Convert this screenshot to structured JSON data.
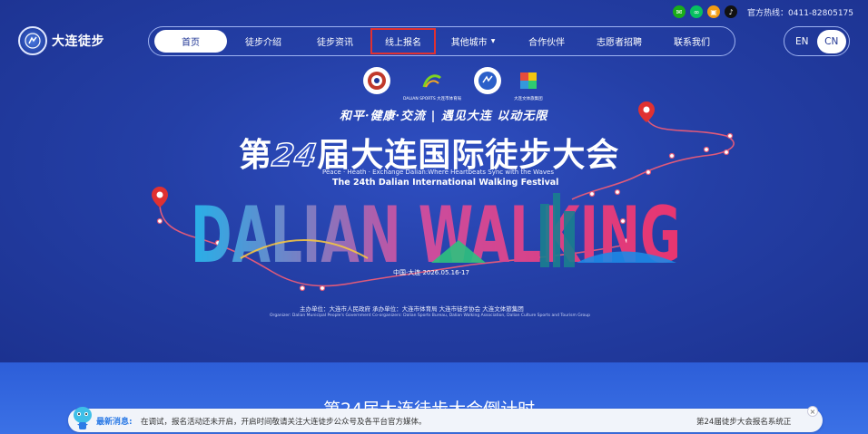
{
  "topbar": {
    "social": [
      {
        "icon": "wechat-icon",
        "color": "#1aad19",
        "glyph": "✉"
      },
      {
        "icon": "miniprogram-icon",
        "color": "#07c160",
        "glyph": "∞"
      },
      {
        "icon": "shop-icon",
        "color": "#f39c12",
        "glyph": "▣"
      },
      {
        "icon": "douyin-icon",
        "color": "#111111",
        "glyph": "♪"
      }
    ],
    "hotline": "官方热线：0411-82805175"
  },
  "logo": {
    "text": "大连徒步"
  },
  "nav": {
    "items": [
      {
        "label": "首页",
        "active": true
      },
      {
        "label": "徒步介绍"
      },
      {
        "label": "徒步资讯"
      },
      {
        "label": "线上报名",
        "highlighted": true
      },
      {
        "label": "其他城市",
        "dropdown": true
      },
      {
        "label": "合作伙伴"
      },
      {
        "label": "志愿者招聘"
      },
      {
        "label": "联系我们"
      }
    ]
  },
  "lang": {
    "en": "EN",
    "cn": "CN",
    "selected": "CN"
  },
  "organizers": [
    {
      "caption": ""
    },
    {
      "caption": "DALIAN SPORTS 大连市体育局"
    },
    {
      "caption": ""
    },
    {
      "caption": "大连文体旅集团"
    }
  ],
  "hero": {
    "slogan": "和平·健康·交流 | 遇见大连 以动无限",
    "title_pre": "第",
    "title_num": "24",
    "title_post": "届大连国际徒步大会",
    "subtitle_en": "Peace · Heath · Exchange    Dalian:Where Heartbeats Sync with the Waves",
    "title_en": "The 24th Dalian International Walking Festival",
    "wordmark": "DALIAN WALKING",
    "date": "中国·大连    2026.05.16-17",
    "hosts": "主办单位：大连市人民政府      承办单位：大连市体育局  大连市徒步协会  大连文体旅集团",
    "organizer_en": "Organizer: Dalian Municipal People's Government    Co-organizers: Dalian Sports Bureau, Dalian Walking Association, Dalian Culture Sports and Tourism Group"
  },
  "countdown": {
    "title": "第24届大连徒步大会倒计时"
  },
  "news": {
    "label": "最新消息:",
    "text": "在调试，报名活动还未开启，开启时间敬请关注大连徒步公众号及各平台官方媒体。",
    "right_text": "第24届徒步大会报名系统正",
    "close": "×"
  },
  "colors": {
    "background": "#1f3594",
    "accent_red": "#e03131",
    "route_red": "#e05a7a",
    "ticker_bg": "#f1f4fa"
  }
}
